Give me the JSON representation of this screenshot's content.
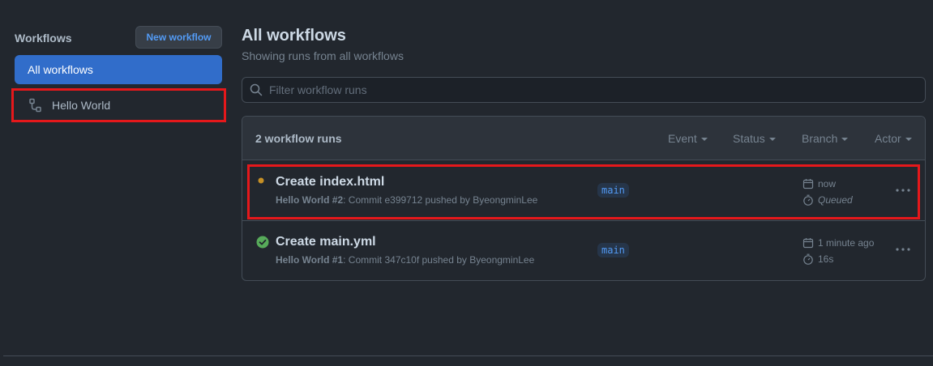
{
  "sidebar": {
    "title": "Workflows",
    "new_workflow_label": "New workflow",
    "items": [
      {
        "label": "All workflows",
        "selected": true
      },
      {
        "label": "Hello World",
        "icon": "workflow-icon",
        "highlighted": true
      }
    ]
  },
  "main": {
    "title": "All workflows",
    "subtitle": "Showing runs from all workflows",
    "filter": {
      "placeholder": "Filter workflow runs",
      "value": ""
    },
    "runs_count": "2 workflow runs",
    "filters": [
      "Event",
      "Status",
      "Branch",
      "Actor"
    ],
    "runs": [
      {
        "title": "Create index.html",
        "workflow": "Hello World #2",
        "description": ": Commit e399712 pushed by ByeongminLee",
        "branch": "main",
        "time": "now",
        "duration": "Queued",
        "status": "queued",
        "highlighted": true
      },
      {
        "title": "Create main.yml",
        "workflow": "Hello World #1",
        "description": ": Commit 347c10f pushed by ByeongminLee",
        "branch": "main",
        "time": "1 minute ago",
        "duration": "16s",
        "status": "success",
        "highlighted": false
      }
    ]
  },
  "colors": {
    "background": "#22272e",
    "accent": "#316dca",
    "link": "#539bf5",
    "success": "#57ab5a",
    "queued": "#c69026",
    "highlight": "#e5181b"
  }
}
